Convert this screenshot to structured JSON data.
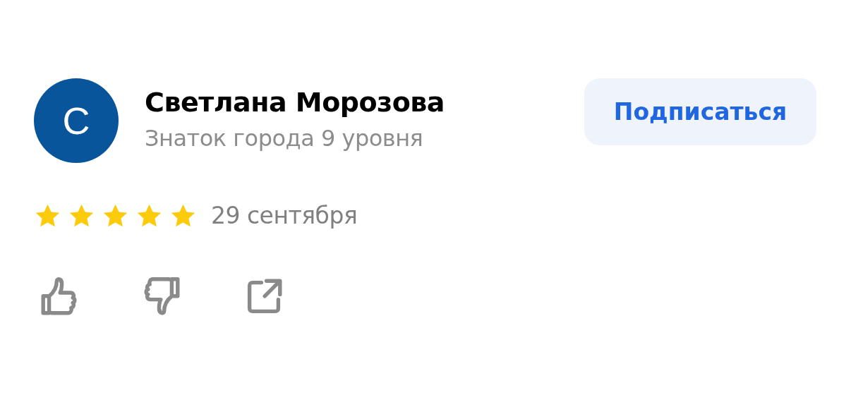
{
  "review": {
    "author": {
      "avatar_letter": "С",
      "name": "Светлана Морозова",
      "level": "Знаток города 9 уровня"
    },
    "subscribe_button": "Подписаться",
    "stars": 5,
    "date": "29 сентября",
    "actions": [
      {
        "kind": "like"
      },
      {
        "kind": "dislike"
      },
      {
        "kind": "share"
      }
    ]
  }
}
